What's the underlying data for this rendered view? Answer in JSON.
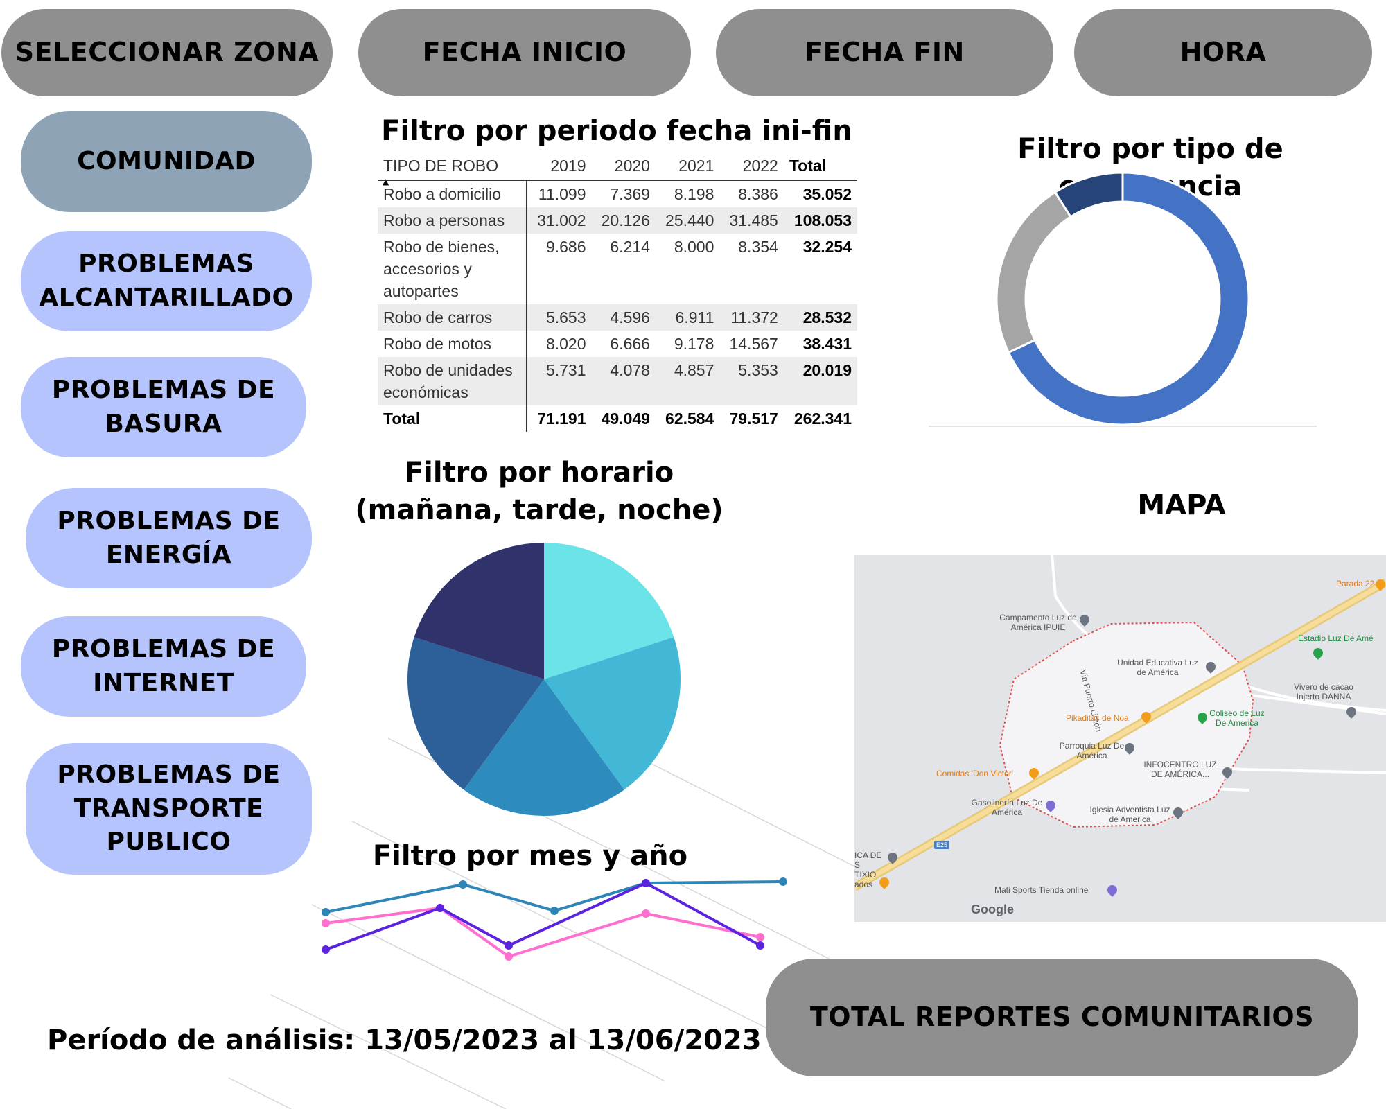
{
  "filters": {
    "zone": "SELECCIONAR ZONA",
    "start_date": "FECHA INICIO",
    "end_date": "FECHA FIN",
    "hour": "HORA"
  },
  "sidebar": {
    "items": [
      {
        "label": "COMUNIDAD",
        "color": "#8ea3b5"
      },
      {
        "label": "PROBLEMAS ALCANTARILLADO",
        "color": "#b6c4fd"
      },
      {
        "label": "PROBLEMAS DE BASURA",
        "color": "#b6c4fd"
      },
      {
        "label": "PROBLEMAS DE ENERGÍA",
        "color": "#b6c4fd"
      },
      {
        "label": "PROBLEMAS DE INTERNET",
        "color": "#b6c4fd"
      },
      {
        "label": "PROBLEMAS DE TRANSPORTE PUBLICO",
        "color": "#b6c4fd"
      }
    ]
  },
  "headings": {
    "table": "Filtro por periodo fecha ini-fin",
    "donut": "Filtro por tipo de emergencia",
    "pie": "Filtro por horario (mañana, tarde, noche)",
    "map": "MAPA",
    "line": "Filtro por mes y año"
  },
  "table": {
    "columns": [
      "TIPO DE ROBO",
      "2019",
      "2020",
      "2021",
      "2022",
      "Total"
    ],
    "rows": [
      [
        "Robo a domicilio",
        "11.099",
        "7.369",
        "8.198",
        "8.386",
        "35.052"
      ],
      [
        "Robo a personas",
        "31.002",
        "20.126",
        "25.440",
        "31.485",
        "108.053"
      ],
      [
        "Robo de bienes, accesorios y autopartes",
        "9.686",
        "6.214",
        "8.000",
        "8.354",
        "32.254"
      ],
      [
        "Robo de carros",
        "5.653",
        "4.596",
        "6.911",
        "11.372",
        "28.532"
      ],
      [
        "Robo de motos",
        "8.020",
        "6.666",
        "9.178",
        "14.567",
        "38.431"
      ],
      [
        "Robo de unidades económicas",
        "5.731",
        "4.078",
        "4.857",
        "5.353",
        "20.019"
      ]
    ],
    "total_row": [
      "Total",
      "71.191",
      "49.049",
      "62.584",
      "79.517",
      "262.341"
    ]
  },
  "chart_data": [
    {
      "type": "pie",
      "variant": "donut",
      "values": [
        68,
        23,
        9
      ],
      "colors": [
        "#4472c4",
        "#a5a5a5",
        "#264478"
      ]
    },
    {
      "type": "pie",
      "values": [
        20,
        20,
        20,
        20,
        20
      ],
      "colors": [
        "#6ae4e8",
        "#42b7d6",
        "#2e8bbd",
        "#2d5f99",
        "#30336b"
      ]
    },
    {
      "type": "line",
      "x": [
        1,
        2,
        3,
        4,
        5,
        6,
        7,
        8,
        9,
        10,
        11
      ],
      "ylim": [
        0,
        10
      ],
      "series": [
        {
          "color": "#2e86b8",
          "x": [
            1,
            4,
            6,
            8,
            11
          ],
          "values": [
            7.2,
            9.2,
            7.3,
            9.3,
            9.4
          ]
        },
        {
          "color": "#ff6fcf",
          "x": [
            1,
            3.5,
            5,
            8,
            10.5
          ],
          "values": [
            6.4,
            7.5,
            4.0,
            7.1,
            5.4
          ]
        },
        {
          "color": "#5b23e0",
          "x": [
            1,
            3.5,
            5,
            8,
            10.5
          ],
          "values": [
            4.5,
            7.5,
            4.8,
            9.3,
            4.8
          ]
        }
      ]
    }
  ],
  "map": {
    "labels": {
      "camp": "Campamento Luz de América IPUIE",
      "parada": "Parada 22",
      "estadio": "Estadio Luz De Amé",
      "unidad": "Unidad Educativa Luz de América",
      "vivero": "Vivero de cacao Injerto DANNA",
      "via": "Via Puerto Limón",
      "pikaditas": "Pikaditas de Noa",
      "coliseo": "Coliseo de Luz De America",
      "parroquia": "Parroquia Luz De América",
      "infocentro": "INFOCENTRO LUZ DE AMÉRICA...",
      "comidas": "Comidas 'Don Victor'",
      "gasolineria": "Gasolinería Luz De América",
      "iglesia": "Iglesia Adventista Luz de America",
      "tixio": "ICA DE S TIXIO",
      "ados": "ados",
      "mati": "Mati Sports Tienda online",
      "google": "Google",
      "e25": "E25"
    }
  },
  "footer": {
    "total_reports": "TOTAL REPORTES COMUNITARIOS",
    "period": "Período de análisis: 13/05/2023 al 13/06/2023"
  }
}
